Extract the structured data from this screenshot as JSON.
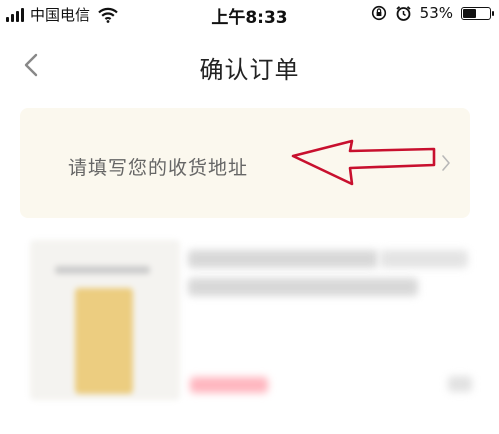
{
  "status_bar": {
    "carrier": "中国电信",
    "time": "上午8:33",
    "battery_percent": "53%",
    "battery_level": 0.53,
    "icons": [
      "signal-icon",
      "wifi-icon",
      "orientation-lock-icon",
      "alarm-icon",
      "battery-icon"
    ]
  },
  "nav": {
    "back_icon": "chevron-left-icon",
    "title": "确认订单"
  },
  "address": {
    "placeholder": "请填写您的收货地址",
    "chevron_icon": "chevron-right-icon",
    "annotation_icon": "red-arrow-annotation-icon"
  },
  "product": {
    "blurred": true
  },
  "colors": {
    "card_background": "#fbf8ee",
    "annotation_red": "#c8102e",
    "price_blur": "#ffb6bf"
  }
}
